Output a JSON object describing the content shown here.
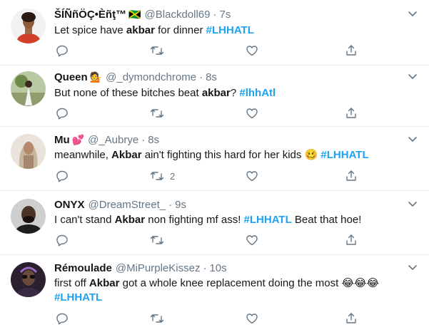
{
  "colors": {
    "link": "#1da1f2",
    "text": "#14171a",
    "muted": "#657786",
    "divider": "#e6ecf0"
  },
  "tweets": [
    {
      "name": "ŠÍÑñÖÇ•Èñţ™",
      "name_emoji": "🇯🇲",
      "handle": "@Blackdoll69",
      "sep": "·",
      "time": "7s",
      "text_pre": "Let spice have ",
      "bold": "akbar",
      "text_mid": " for dinner ",
      "hashtag": "#LHHATL",
      "retweet_count": "",
      "avatar_icon": "avatar-woman-red-top"
    },
    {
      "name": "Queen",
      "name_emoji": "💁",
      "handle": "@_dymondchrome",
      "sep": "·",
      "time": "8s",
      "text_pre": "But none of these bitches beat ",
      "bold": "akbar",
      "text_mid": "? ",
      "hashtag": "#lhhAtl",
      "retweet_count": "",
      "avatar_icon": "avatar-woman-outdoors"
    },
    {
      "name": "Mu",
      "name_emoji": "💕",
      "handle": "@_Aubrye",
      "sep": "·",
      "time": "8s",
      "text_pre": "meanwhile, ",
      "bold": "Akbar",
      "text_mid": " ain't fighting this hard for her kids 🥴 ",
      "hashtag": "#LHHATL",
      "retweet_count": "2",
      "avatar_icon": "avatar-woman-long-hair"
    },
    {
      "name": "ONYX",
      "name_emoji": "",
      "handle": "@DreamStreet_",
      "sep": "·",
      "time": "9s",
      "text_pre": "I can't stand ",
      "bold": "Akbar",
      "text_mid": " non fighting mf ass! ",
      "hashtag": "#LHHATL",
      "text_post": " Beat that hoe!",
      "retweet_count": "",
      "avatar_icon": "avatar-man-dark"
    },
    {
      "name": "Rémoulade",
      "name_emoji": "",
      "handle": "@MiPurpleKissez",
      "sep": "·",
      "time": "10s",
      "text_pre": "first off ",
      "bold": "Akbar",
      "text_mid": " got a whole knee replacement doing the most 😂😂😂",
      "hashtag": "#LHHATL",
      "retweet_count": "",
      "avatar_icon": "avatar-woman-glasses"
    }
  ]
}
